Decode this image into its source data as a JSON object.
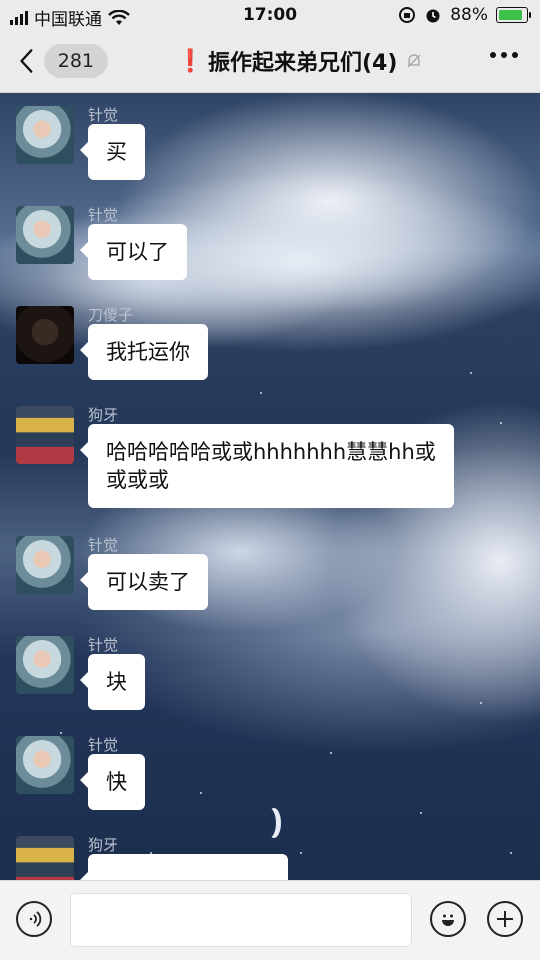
{
  "status_bar": {
    "carrier": "中国联通",
    "time": "17:00",
    "battery_percent": "88%",
    "battery_level": 0.88
  },
  "header": {
    "back_count": "281",
    "title_mark": "❗",
    "title": "振作起来弟兄们(4)"
  },
  "messages": [
    {
      "sender": "针觉",
      "text": "买",
      "avatar": "a"
    },
    {
      "sender": "针觉",
      "text": "可以了",
      "avatar": "a"
    },
    {
      "sender": "刀傻子",
      "text": "我托运你",
      "avatar": "b"
    },
    {
      "sender": "狗牙",
      "text": "哈哈哈哈哈或或hhhhhhh慧慧hh或或或或",
      "avatar": "c"
    },
    {
      "sender": "针觉",
      "text": "可以卖了",
      "avatar": "a"
    },
    {
      "sender": "针觉",
      "text": "块",
      "avatar": "a"
    },
    {
      "sender": "针觉",
      "text": "快",
      "avatar": "a"
    },
    {
      "sender": "狗牙",
      "text": "",
      "avatar": "c"
    }
  ],
  "input": {
    "value": "",
    "placeholder": ""
  },
  "icons": {
    "voice": "voice-icon",
    "emoji": "emoji-icon",
    "plus": "plus-icon",
    "mute": "bell-mute-icon"
  }
}
